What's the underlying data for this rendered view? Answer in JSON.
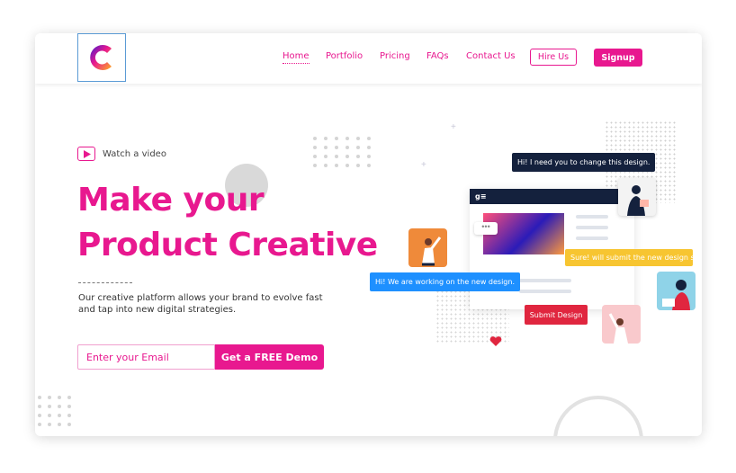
{
  "colors": {
    "brand": "#e8188f",
    "dark_bubble": "#14213d",
    "blue_bubble": "#1e90ff",
    "yellow_bubble": "#f7c531",
    "red_button": "#e0263f"
  },
  "nav": {
    "logo_icon": "c-logo-icon",
    "links": [
      "Home",
      "Portfolio",
      "Pricing",
      "FAQs",
      "Contact Us"
    ],
    "hire_label": "Hire Us",
    "signup_label": "Signup"
  },
  "hero": {
    "watch_label": "Watch a video",
    "title_line1": "Make your",
    "title_line2": "Product Creative",
    "description": "Our creative platform allows your brand to evolve fast and tap into new digital strategies.",
    "email_placeholder": "Enter your Email",
    "demo_label": "Get a FREE Demo"
  },
  "illustration": {
    "bubble_top": "Hi! I need you to change this design.",
    "bubble_right": "Sure! will submit the new design shortly.",
    "bubble_left": "Hi! We are working on the new design.",
    "submit_label": "Submit Design",
    "window_brand": "g≡"
  }
}
